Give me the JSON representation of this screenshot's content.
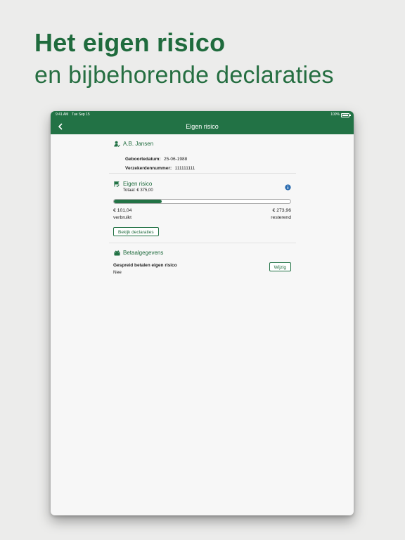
{
  "headline": {
    "bold": "Het eigen risico",
    "light": "en bijbehorende declaraties"
  },
  "status_bar": {
    "time": "9:41 AM",
    "date": "Tue Sep 15",
    "battery": "100%"
  },
  "navbar": {
    "title": "Eigen risico"
  },
  "user": {
    "name": "A.B. Jansen",
    "dob_label": "Geboortedatum:",
    "dob_value": "25-06-1988",
    "policy_label": "Verzekerdennummer:",
    "policy_value": "111111111"
  },
  "eigen_risico": {
    "title": "Eigen risico",
    "total": "Totaal: € 375,00",
    "progress_fraction": 0.27,
    "used_amount": "€ 101,04",
    "used_label": "verbruikt",
    "remaining_amount": "€ 273,96",
    "remaining_label": "resterend",
    "button_label": "Bekijk declaraties"
  },
  "betaalgegevens": {
    "title": "Betaalgegevens",
    "spread_label": "Gespreid betalen eigen risico",
    "spread_value": "Nee",
    "edit_label": "Wijzig"
  },
  "colors": {
    "brand_green": "#227245",
    "info_blue": "#2b6cb0",
    "background": "#ececeb"
  },
  "icons": {
    "back": "chevron-left-icon",
    "user": "user-icon",
    "risk": "flag-icon",
    "info": "info-icon",
    "wallet": "wallet-icon"
  }
}
